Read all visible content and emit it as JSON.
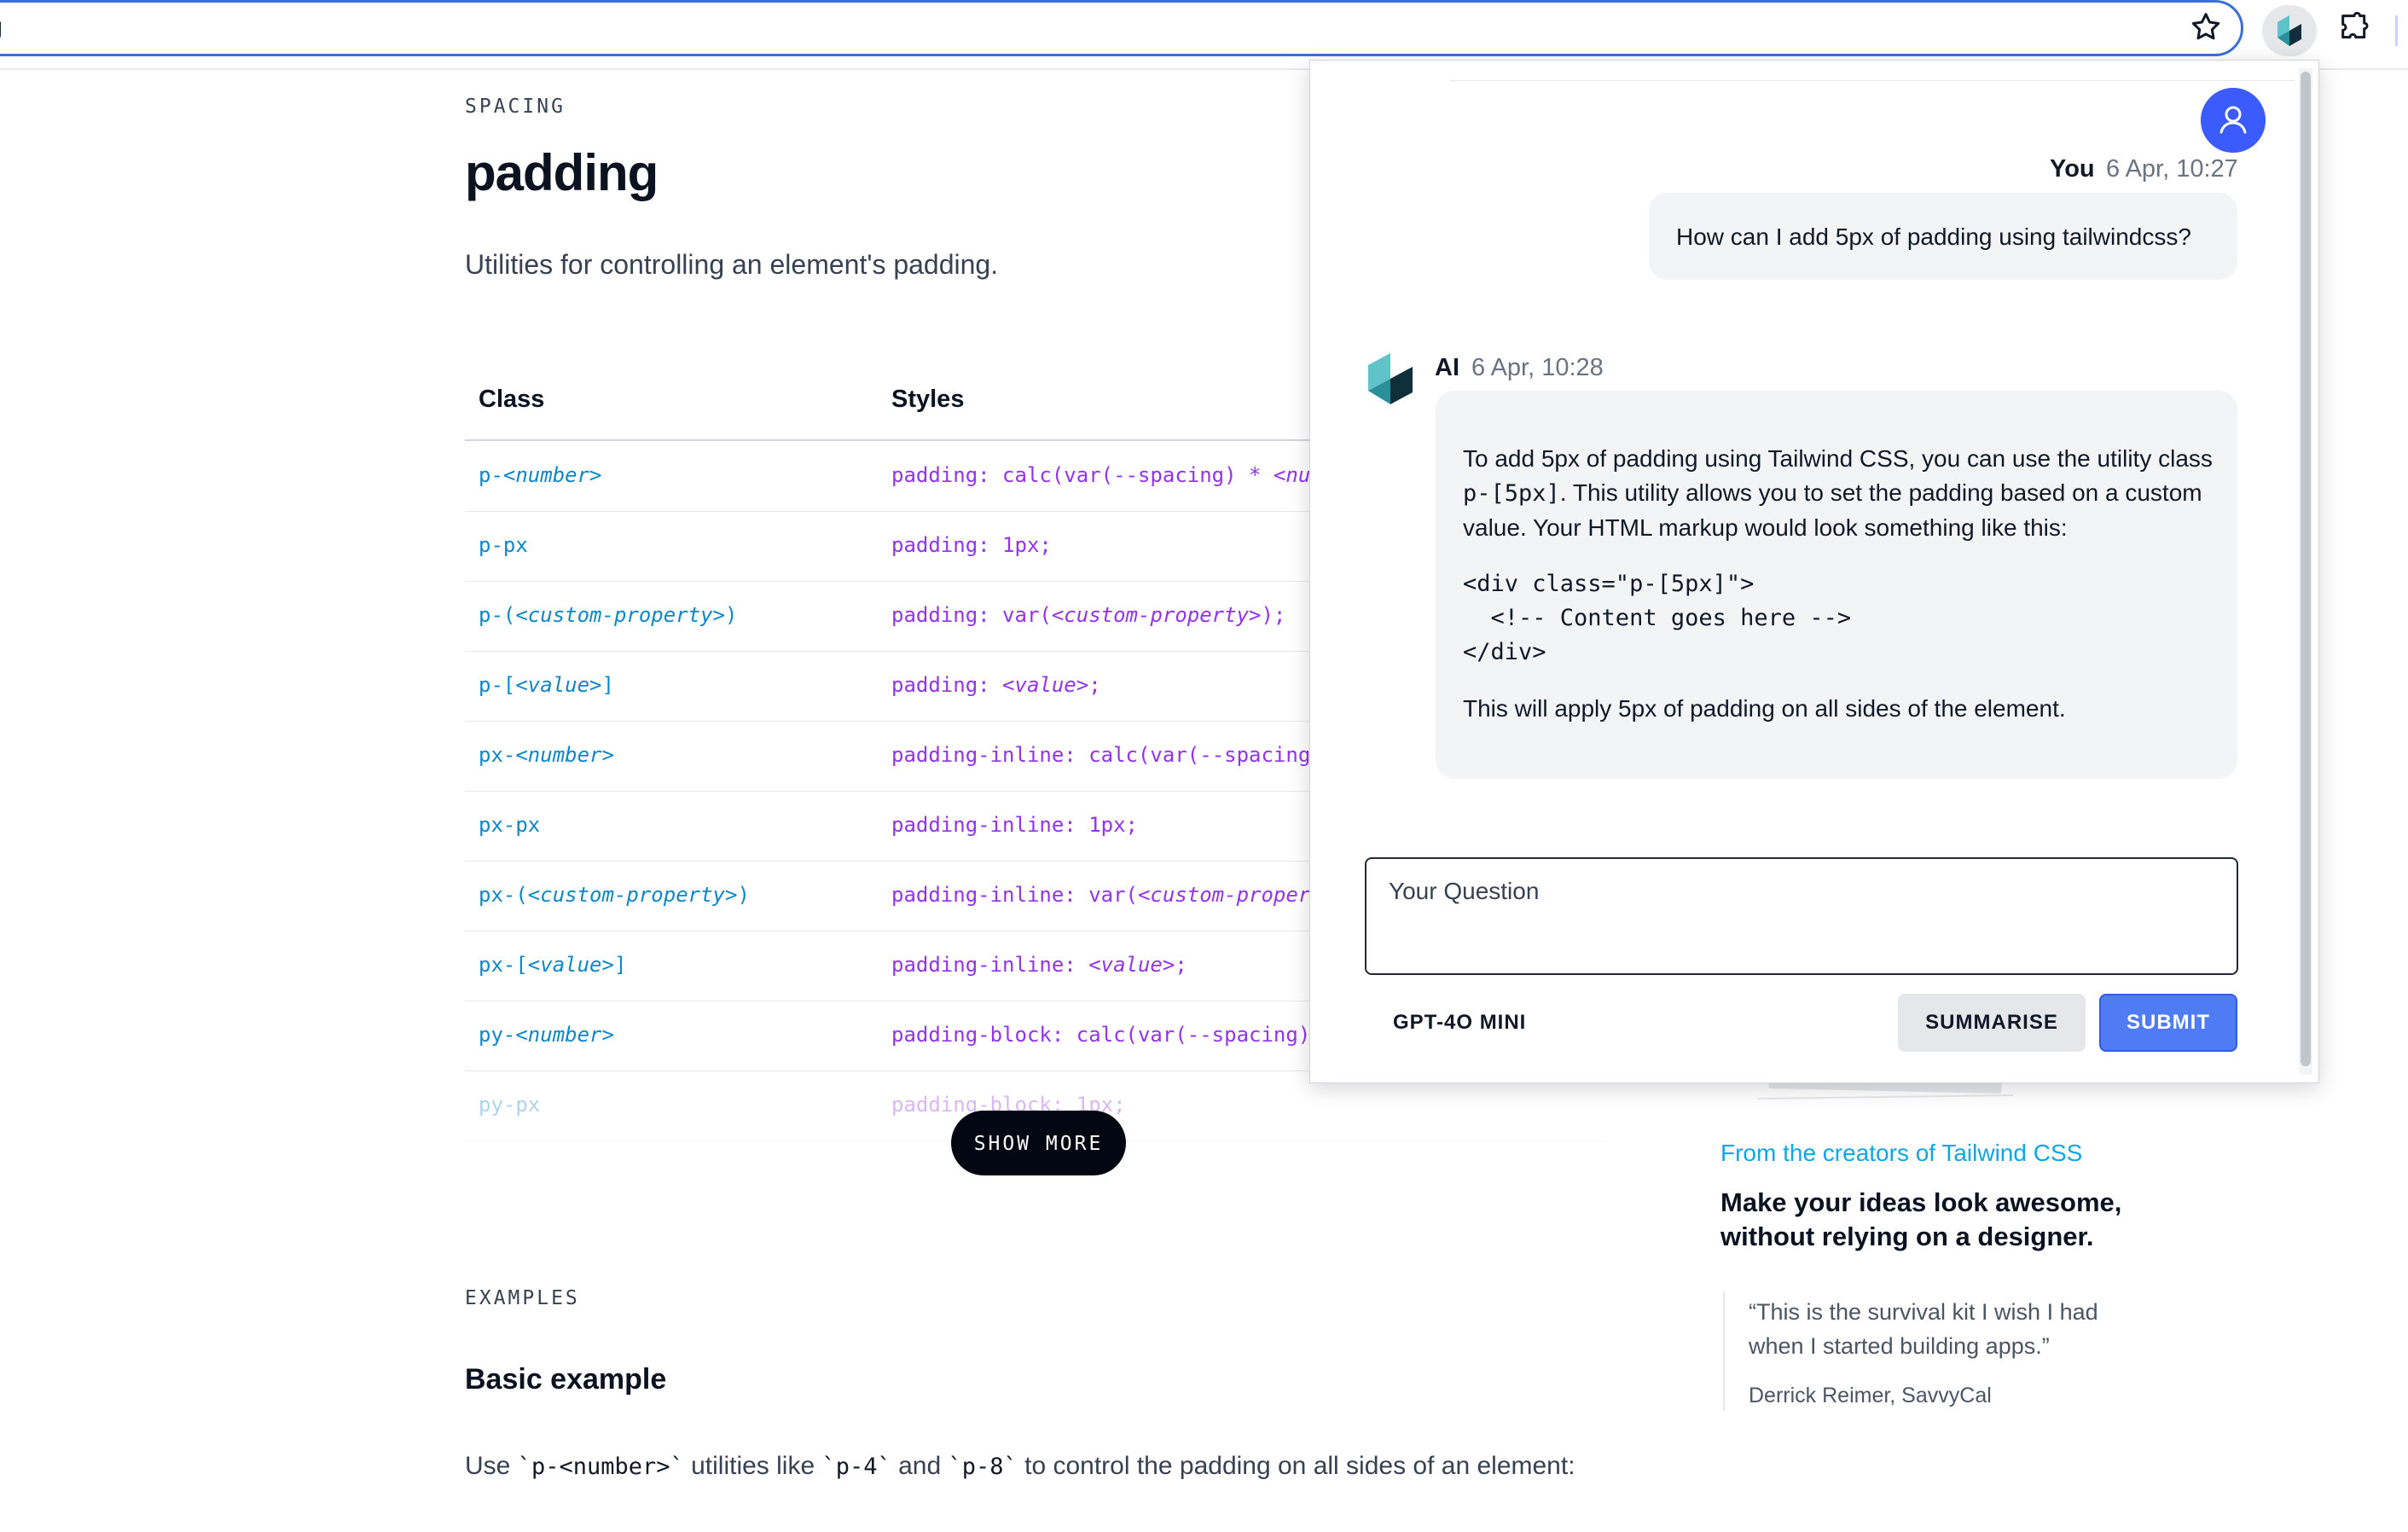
{
  "browser": {
    "url_fragment": "ing"
  },
  "docs": {
    "eyebrow": "SPACING",
    "title": "padding",
    "subtitle": "Utilities for controlling an element's padding.",
    "table": {
      "headers": [
        "Class",
        "Styles"
      ],
      "rows": [
        {
          "class_prefix": "p-",
          "class_ph": "<number>",
          "class_suffix": "",
          "style_prefix": "padding: calc(var(--spacing) * ",
          "style_ph": "<nu",
          "style_suffix": ""
        },
        {
          "class_prefix": "p-px",
          "class_ph": "",
          "class_suffix": "",
          "style_prefix": "padding: 1px;",
          "style_ph": "",
          "style_suffix": ""
        },
        {
          "class_prefix": "p-(",
          "class_ph": "<custom-property>",
          "class_suffix": ")",
          "style_prefix": "padding: var(",
          "style_ph": "<custom-property>",
          "style_suffix": ");"
        },
        {
          "class_prefix": "p-[",
          "class_ph": "<value>",
          "class_suffix": "]",
          "style_prefix": "padding: ",
          "style_ph": "<value>",
          "style_suffix": ";"
        },
        {
          "class_prefix": "px-",
          "class_ph": "<number>",
          "class_suffix": "",
          "style_prefix": "padding-inline: calc(var(--spacing",
          "style_ph": "",
          "style_suffix": ""
        },
        {
          "class_prefix": "px-px",
          "class_ph": "",
          "class_suffix": "",
          "style_prefix": "padding-inline: 1px;",
          "style_ph": "",
          "style_suffix": ""
        },
        {
          "class_prefix": "px-(",
          "class_ph": "<custom-property>",
          "class_suffix": ")",
          "style_prefix": "padding-inline: var(",
          "style_ph": "<custom-proper",
          "style_suffix": ""
        },
        {
          "class_prefix": "px-[",
          "class_ph": "<value>",
          "class_suffix": "]",
          "style_prefix": "padding-inline: ",
          "style_ph": "<value>",
          "style_suffix": ";"
        },
        {
          "class_prefix": "py-",
          "class_ph": "<number>",
          "class_suffix": "",
          "style_prefix": "padding-block: calc(var(--spacing)",
          "style_ph": "",
          "style_suffix": ""
        },
        {
          "class_prefix": "py-px",
          "class_ph": "",
          "class_suffix": "",
          "style_prefix": "padding-block: 1px;",
          "style_ph": "",
          "style_suffix": ""
        }
      ]
    },
    "show_more": "SHOW MORE",
    "examples_eyebrow": "EXAMPLES",
    "basic_title": "Basic example",
    "basic_desc": {
      "pre": "Use ",
      "code1": "`p-<number>`",
      "mid1": " utilities like ",
      "code2": "`p-4`",
      "mid2": " and ",
      "code3": "`p-8`",
      "post": " to control the padding on all sides of an element:"
    }
  },
  "ad": {
    "from": "From the creators of Tailwind CSS",
    "headline": "Make your ideas look awesome, without relying on a designer.",
    "quote": "“This is the survival kit I wish I had when I started building apps.”",
    "author": "Derrick Reimer, SavvyCal"
  },
  "chat": {
    "user": {
      "name": "You",
      "time": "6 Apr, 10:27",
      "message": "How can I add 5px of padding using tailwindcss?"
    },
    "ai": {
      "name": "AI",
      "time": "6 Apr, 10:28",
      "p1_pre": "To add 5px of padding using Tailwind CSS, you can use the utility class ",
      "p1_code": "p-[5px]",
      "p1_post": ". This utility allows you to set the padding based on a custom value. Your HTML markup would look something like this:",
      "code": "<div class=\"p-[5px]\">\n  <!-- Content goes here -->\n</div>",
      "p2": "This will apply 5px of padding on all sides of the element."
    },
    "input_placeholder": "Your Question",
    "model": "GPT-4O MINI",
    "summarise_label": "SUMMARISE",
    "submit_label": "SUBMIT"
  },
  "colors": {
    "accent": "#3b5bfd",
    "submit": "#4f7cf5",
    "class_text": "#0e87c9",
    "style_text": "#9333ea",
    "ad_link": "#0ea5e9"
  },
  "icons": {
    "star": "star-icon",
    "extension": "puzzle-icon",
    "avatar": "user-icon",
    "ai_logo": "cube-logo"
  }
}
